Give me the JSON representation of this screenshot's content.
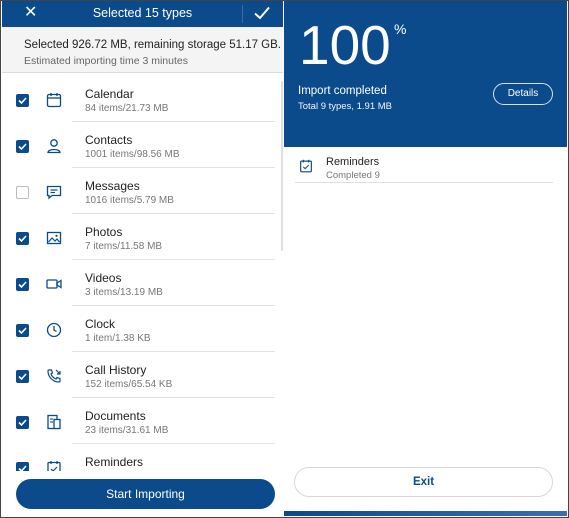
{
  "left": {
    "header": {
      "close_icon": "close-icon",
      "title": "Selected 15 types",
      "confirm_icon": "check-icon"
    },
    "summary": {
      "line1": "Selected 926.72 MB, remaining storage 51.17 GB.",
      "line2": "Estimated importing time 3 minutes"
    },
    "items": [
      {
        "name": "Calendar",
        "meta": "84 items/21.73 MB",
        "checked": true,
        "icon": "calendar-icon"
      },
      {
        "name": "Contacts",
        "meta": "1001 items/98.56 MB",
        "checked": true,
        "icon": "contact-icon"
      },
      {
        "name": "Messages",
        "meta": "1016 items/5.79 MB",
        "checked": false,
        "icon": "message-icon"
      },
      {
        "name": "Photos",
        "meta": "7 items/11.58 MB",
        "checked": true,
        "icon": "photo-icon"
      },
      {
        "name": "Videos",
        "meta": "3 items/13.19 MB",
        "checked": true,
        "icon": "video-icon"
      },
      {
        "name": "Clock",
        "meta": "1 item/1.38 KB",
        "checked": true,
        "icon": "clock-icon"
      },
      {
        "name": "Call History",
        "meta": "152 items/65.54 KB",
        "checked": true,
        "icon": "call-history-icon"
      },
      {
        "name": "Documents",
        "meta": "23 items/31.61 MB",
        "checked": true,
        "icon": "document-icon"
      },
      {
        "name": "Reminders",
        "meta": "",
        "checked": true,
        "icon": "reminder-icon"
      }
    ],
    "start_button": "Start Importing"
  },
  "right": {
    "percent": "100",
    "percent_sign": "%",
    "status": "Import completed",
    "total": "Total 9 types, 1.91 MB",
    "details_button": "Details",
    "completed_item": {
      "name": "Reminders",
      "sub": "Completed  9",
      "icon": "reminder-icon"
    },
    "exit_button": "Exit"
  },
  "colors": {
    "primary": "#0b4a8b",
    "background": "#ffffff"
  }
}
